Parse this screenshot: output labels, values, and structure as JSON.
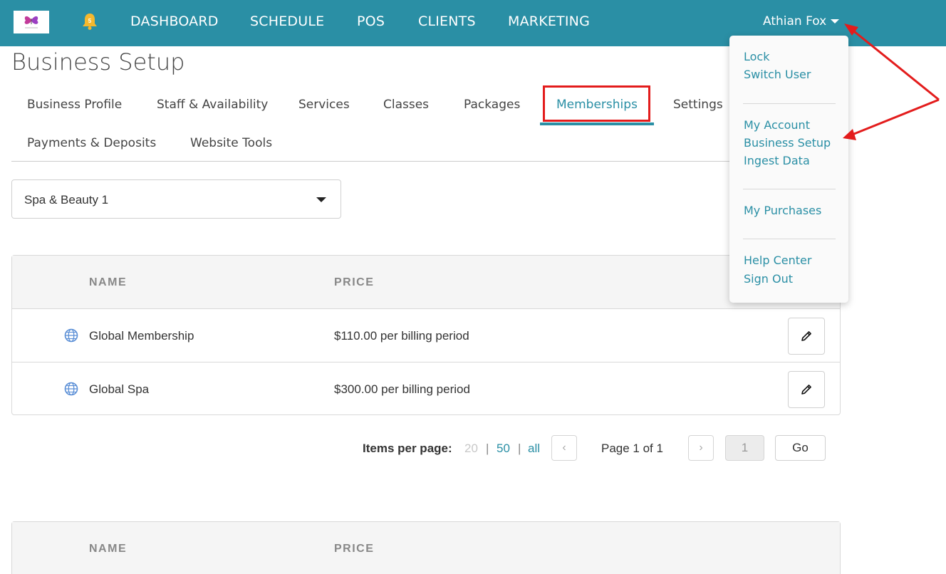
{
  "nav": {
    "notification_count": "5",
    "items": [
      "DASHBOARD",
      "SCHEDULE",
      "POS",
      "CLIENTS",
      "MARKETING"
    ],
    "user_name": "Athian Fox"
  },
  "page": {
    "title": "Business Setup"
  },
  "tabs": [
    {
      "label": "Business Profile"
    },
    {
      "label": "Staff & Availability"
    },
    {
      "label": "Services"
    },
    {
      "label": "Classes"
    },
    {
      "label": "Packages"
    },
    {
      "label": "Memberships",
      "active": true
    },
    {
      "label": "Settings"
    },
    {
      "label": "Payments & Deposits"
    },
    {
      "label": "Website Tools"
    }
  ],
  "location_select": {
    "value": "Spa & Beauty 1"
  },
  "memberships_table": {
    "columns": [
      "NAME",
      "PRICE"
    ],
    "rows": [
      {
        "name": "Global Membership",
        "price": "$110.00 per billing period"
      },
      {
        "name": "Global Spa",
        "price": "$300.00 per billing period"
      }
    ]
  },
  "pagination": {
    "label": "Items per page:",
    "options": [
      "20",
      "50",
      "all"
    ],
    "separator": "|",
    "prev": "‹",
    "next": "›",
    "page_text": "Page 1 of 1",
    "page_input": "1",
    "go": "Go"
  },
  "second_table": {
    "columns": [
      "NAME",
      "PRICE"
    ]
  },
  "user_dropdown": {
    "groups": [
      [
        "Lock",
        "Switch User"
      ],
      [
        "My Account",
        "Business Setup",
        "Ingest Data"
      ],
      [
        "My Purchases"
      ],
      [
        "Help Center",
        "Sign Out"
      ]
    ]
  },
  "colors": {
    "brand": "#2a8fa5",
    "annotation": "#e31c1c",
    "bell": "#f5b82e"
  }
}
